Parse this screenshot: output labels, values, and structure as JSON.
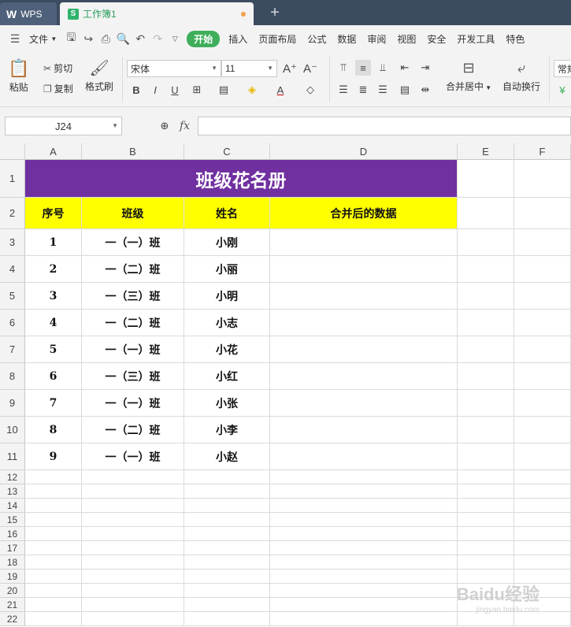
{
  "tabs": {
    "wps_label": "WPS",
    "doc_icon": "S",
    "doc_title": "工作簿1",
    "new_tab": "+"
  },
  "menu": {
    "file": "文件",
    "items": [
      "开始",
      "插入",
      "页面布局",
      "公式",
      "数据",
      "审阅",
      "视图",
      "安全",
      "开发工具",
      "特色"
    ]
  },
  "ribbon": {
    "paste": "粘贴",
    "cut": "剪切",
    "copy": "复制",
    "format_painter": "格式刷",
    "font_name": "宋体",
    "font_size": "11",
    "merge_center": "合并居中",
    "wrap_text": "自动换行",
    "normal": "常规"
  },
  "formula_bar": {
    "cell_ref": "J24",
    "fx": "fx",
    "value": ""
  },
  "columns": [
    "A",
    "B",
    "C",
    "D",
    "E",
    "F"
  ],
  "rows": [
    "1",
    "2",
    "3",
    "4",
    "5",
    "6",
    "7",
    "8",
    "9",
    "10",
    "11",
    "12",
    "13",
    "14",
    "15",
    "16",
    "17",
    "18",
    "19",
    "20",
    "21",
    "22"
  ],
  "sheet": {
    "title": "班级花名册",
    "headers": [
      "序号",
      "班级",
      "姓名",
      "合并后的数据"
    ],
    "data": [
      [
        "1",
        "一（一）班",
        "小刚",
        ""
      ],
      [
        "2",
        "一（二）班",
        "小丽",
        ""
      ],
      [
        "3",
        "一（三）班",
        "小明",
        ""
      ],
      [
        "4",
        "一（二）班",
        "小志",
        ""
      ],
      [
        "5",
        "一（一）班",
        "小花",
        ""
      ],
      [
        "6",
        "一（三）班",
        "小红",
        ""
      ],
      [
        "7",
        "一（一）班",
        "小张",
        ""
      ],
      [
        "8",
        "一（二）班",
        "小李",
        ""
      ],
      [
        "9",
        "一（一）班",
        "小赵",
        ""
      ]
    ]
  },
  "watermark": {
    "brand": "Baidu经验",
    "url": "jingyan.baidu.com"
  },
  "colors": {
    "title_bg": "#7030a0",
    "header_bg": "#ffff00",
    "accent": "#3eae5a"
  }
}
